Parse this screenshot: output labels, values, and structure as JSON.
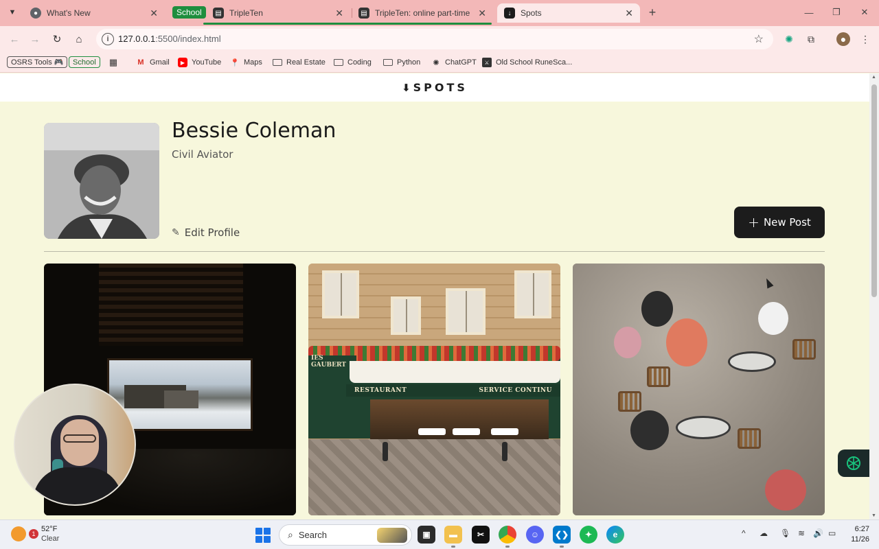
{
  "browser": {
    "tabs": [
      {
        "title": "What's New",
        "favicon": "chrome-icon",
        "active": false
      },
      {
        "title": "TripleTen",
        "favicon": "tripleten-icon",
        "active": false,
        "group": "School"
      },
      {
        "title": "TripleTen: online part-time codi",
        "favicon": "tripleten-icon",
        "active": false,
        "group": "School"
      },
      {
        "title": "Spots",
        "favicon": "spots-icon",
        "active": true
      }
    ],
    "tab_group_label": "School",
    "new_tab_symbol": "+",
    "close_symbol": "✕",
    "url_host": "127.0.0.1",
    "url_path": ":5500/index.html",
    "bookmarks": [
      {
        "label": "OSRS Tools 🎮",
        "icon": "chip"
      },
      {
        "label": "School",
        "icon": "chip-green"
      },
      {
        "label": "",
        "icon": "apps-grid-icon"
      },
      {
        "label": "Gmail",
        "icon": "gmail-icon"
      },
      {
        "label": "YouTube",
        "icon": "youtube-icon"
      },
      {
        "label": "Maps",
        "icon": "maps-icon"
      },
      {
        "label": "Real Estate",
        "icon": "folder-icon"
      },
      {
        "label": "Coding",
        "icon": "folder-icon"
      },
      {
        "label": "Python",
        "icon": "folder-icon"
      },
      {
        "label": "ChatGPT",
        "icon": "chatgpt-icon"
      },
      {
        "label": "Old School RuneSca...",
        "icon": "runescape-icon"
      }
    ]
  },
  "page": {
    "logo": "SPOTS",
    "logo_mark": "⬇",
    "profile": {
      "name": "Bessie Coleman",
      "description": "Civil Aviator",
      "edit_label": "Edit Profile",
      "new_post_label": "New Post"
    },
    "cards": [
      {
        "name": "card-window-view"
      },
      {
        "name": "card-paris-restaurant",
        "sign_left": "RESTAURANT",
        "sign_right": "SERVICE CONTINU",
        "side_sign": "IES GAUBERT"
      },
      {
        "name": "card-cafe-terrace"
      }
    ]
  },
  "taskbar": {
    "weather_temp": "52°F",
    "weather_desc": "Clear",
    "weather_badge": "1",
    "search_placeholder": "Search",
    "time": "6:27",
    "date": "11/26"
  },
  "colors": {
    "page_bg": "#f7f7dc",
    "button_dark": "#1c1c1c",
    "tab_strip": "#f3b8b8",
    "group_green": "#1e8e3e"
  }
}
